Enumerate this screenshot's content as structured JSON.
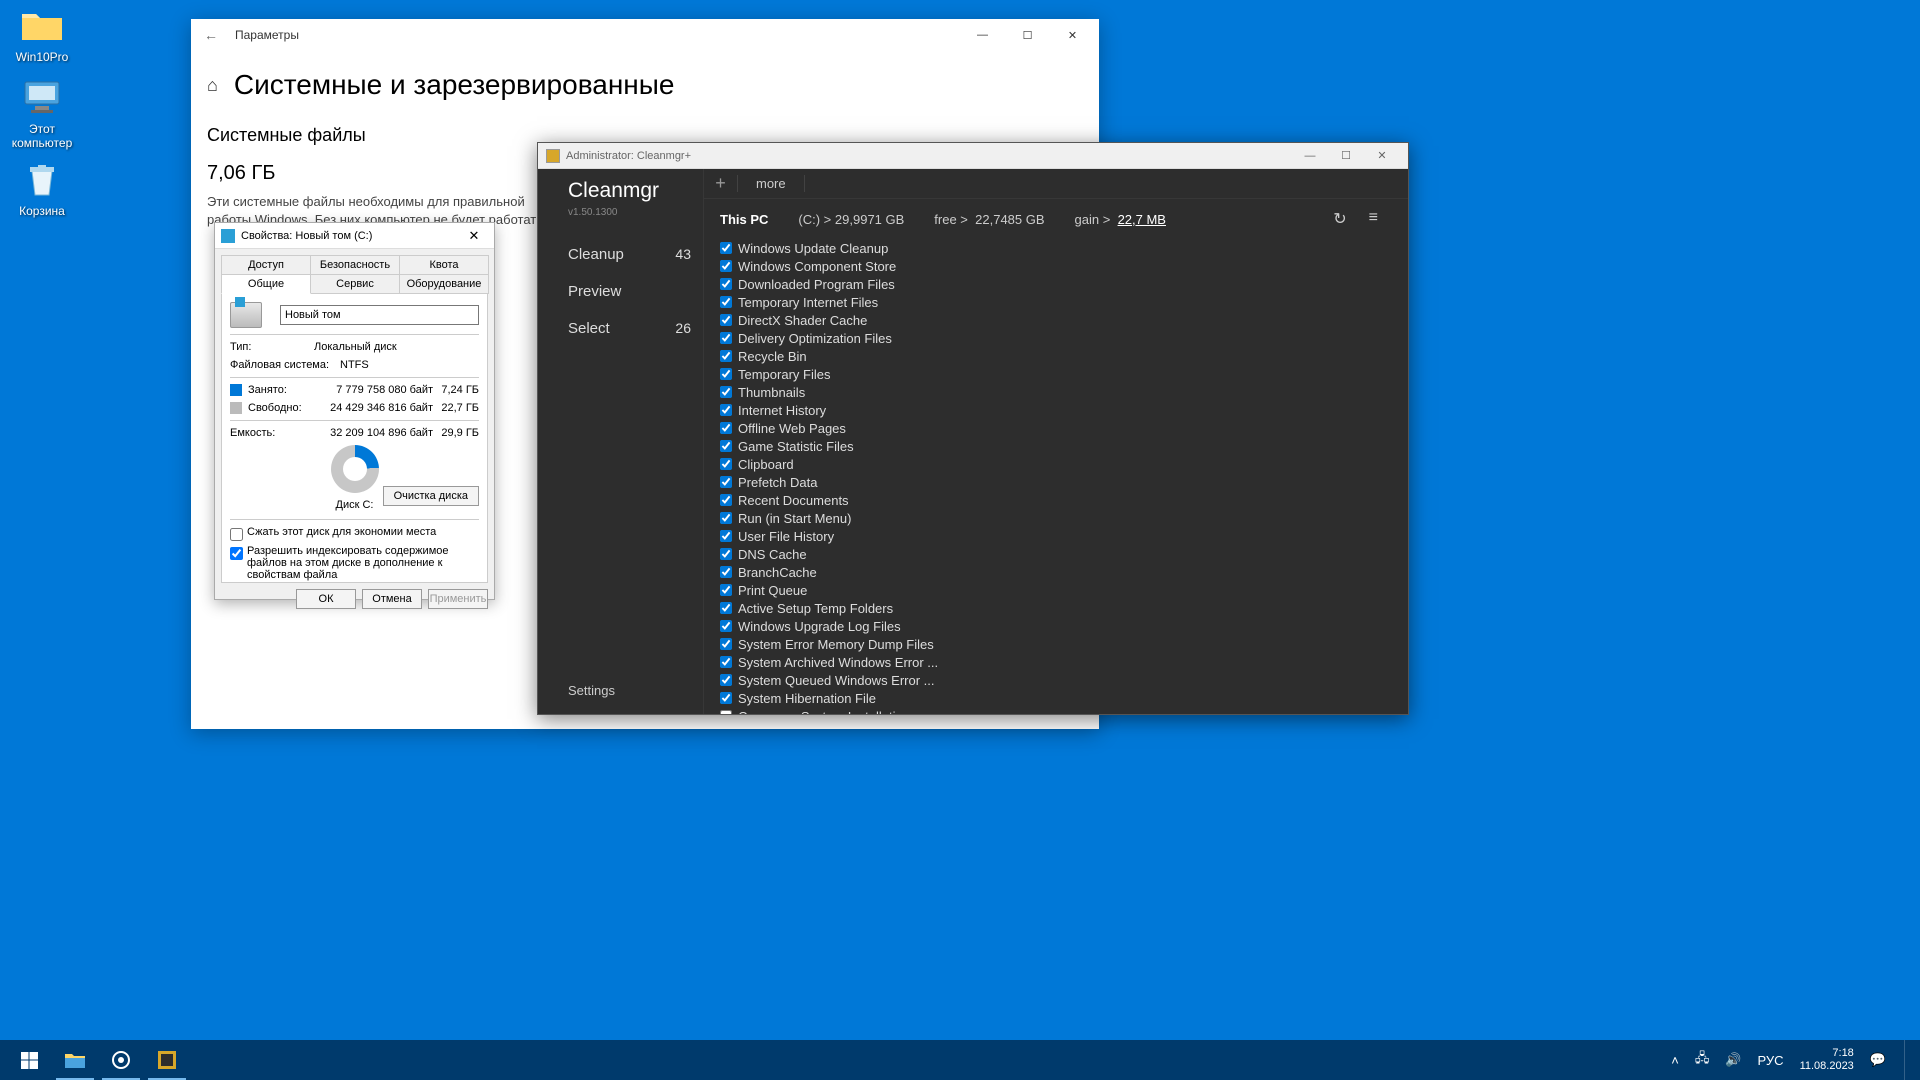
{
  "desktop": {
    "icons": [
      {
        "name": "win10pro-icon",
        "label": "Win10Pro"
      },
      {
        "name": "this-pc-icon",
        "label": "Этот\nкомпьютер"
      },
      {
        "name": "recycle-bin-icon",
        "label": "Корзина"
      }
    ]
  },
  "settings": {
    "titlebar": "Параметры",
    "heading": "Системные и зарезервированные",
    "subheading": "Системные файлы",
    "size": "7,06 ГБ",
    "description": "Эти системные файлы необходимы для правильной работы Windows. Без них компьютер не будет работать."
  },
  "props": {
    "title": "Свойства: Новый том (C:)",
    "tabs_row1": [
      "Доступ",
      "Безопасность",
      "Квота"
    ],
    "tabs_row2": [
      "Общие",
      "Сервис",
      "Оборудование"
    ],
    "active_tab": "Общие",
    "volume_name": "Новый том",
    "type_label": "Тип:",
    "type_value": "Локальный диск",
    "fs_label": "Файловая система:",
    "fs_value": "NTFS",
    "used_label": "Занято:",
    "used_bytes": "7 779 758 080 байт",
    "used_gb": "7,24 ГБ",
    "free_label": "Свободно:",
    "free_bytes": "24 429 346 816 байт",
    "free_gb": "22,7 ГБ",
    "cap_label": "Емкость:",
    "cap_bytes": "32 209 104 896 байт",
    "cap_gb": "29,9 ГБ",
    "disk_name": "Диск C:",
    "cleanup_btn": "Очистка диска",
    "compress_cb": "Сжать этот диск для экономии места",
    "index_cb": "Разрешить индексировать содержимое файлов на этом диске в дополнение к свойствам файла",
    "ok": "ОК",
    "cancel": "Отмена",
    "apply": "Применить"
  },
  "clean": {
    "title": "Administrator: Cleanmgr+",
    "logo": "Cleanmgr",
    "more": "more",
    "version": "v1.50.1300",
    "nav": [
      {
        "label": "Cleanup",
        "count": "43"
      },
      {
        "label": "Preview",
        "count": ""
      },
      {
        "label": "Select",
        "count": "26"
      }
    ],
    "settings": "Settings",
    "stats": {
      "pc": "This PC",
      "c_lbl": "(C:) >",
      "c_val": "29,9971 GB",
      "free_lbl": "free  >",
      "free_val": "22,7485 GB",
      "gain_lbl": "gain >",
      "gain_val": "22,7 MB"
    },
    "items": [
      {
        "label": "Windows Update Cleanup",
        "checked": true
      },
      {
        "label": "Windows Component Store",
        "checked": true
      },
      {
        "label": "Downloaded Program Files",
        "checked": true
      },
      {
        "label": "Temporary Internet Files",
        "checked": true
      },
      {
        "label": "DirectX Shader Cache",
        "checked": true
      },
      {
        "label": "Delivery Optimization Files",
        "checked": true
      },
      {
        "label": "Recycle Bin",
        "checked": true
      },
      {
        "label": "Temporary Files",
        "checked": true
      },
      {
        "label": "Thumbnails",
        "checked": true
      },
      {
        "label": "Internet History",
        "checked": true
      },
      {
        "label": "Offline Web Pages",
        "checked": true
      },
      {
        "label": "Game Statistic Files",
        "checked": true
      },
      {
        "label": "Clipboard",
        "checked": true
      },
      {
        "label": "Prefetch Data",
        "checked": true
      },
      {
        "label": "Recent Documents",
        "checked": true
      },
      {
        "label": "Run (in Start Menu)",
        "checked": true
      },
      {
        "label": "User File History",
        "checked": true
      },
      {
        "label": "DNS Cache",
        "checked": true
      },
      {
        "label": "BranchCache",
        "checked": true
      },
      {
        "label": "Print Queue",
        "checked": true
      },
      {
        "label": "Active Setup Temp Folders",
        "checked": true
      },
      {
        "label": "Windows Upgrade Log Files",
        "checked": true
      },
      {
        "label": "System Error Memory Dump Files",
        "checked": true
      },
      {
        "label": "System Archived Windows Error ...",
        "checked": true
      },
      {
        "label": "System Queued Windows Error ...",
        "checked": true
      },
      {
        "label": "System Hibernation File",
        "checked": true
      },
      {
        "label": "Compress System Installation",
        "checked": false
      }
    ]
  },
  "taskbar": {
    "lang": "РУС",
    "time": "7:18",
    "date": "11.08.2023"
  }
}
